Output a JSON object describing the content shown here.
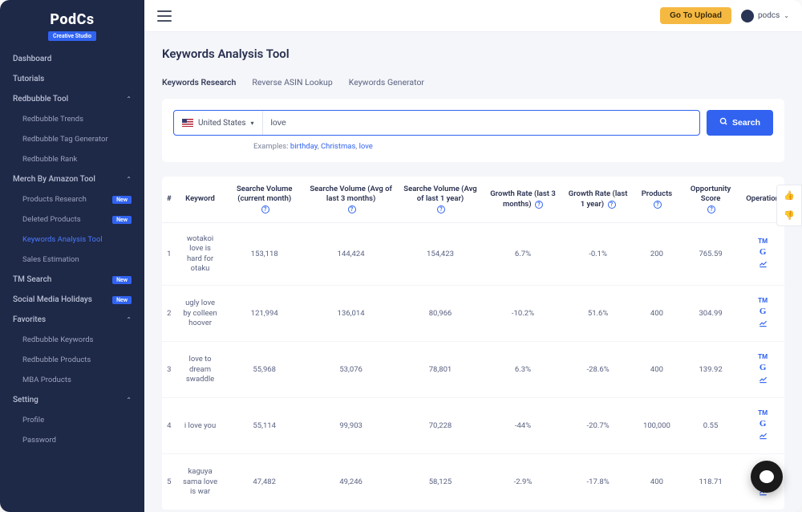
{
  "logo": {
    "brand": "PodCs",
    "sub": "Creative Studio"
  },
  "topbar": {
    "upload_btn": "Go To Upload",
    "username": "podcs"
  },
  "sidebar": {
    "dashboard": "Dashboard",
    "tutorials": "Tutorials",
    "redbubble_tool": "Redbubble Tool",
    "redbubble_trends": "Redbubble Trends",
    "redbubble_tag_gen": "Redbubble Tag Generator",
    "redbubble_rank": "Redbubble Rank",
    "merch_tool": "Merch By Amazon Tool",
    "products_research": "Products Research",
    "deleted_products": "Deleted Products",
    "keywords_analysis": "Keywords Analysis Tool",
    "sales_estimation": "Sales Estimation",
    "tm_search": "TM Search",
    "social_media": "Social Media Holidays",
    "favorites": "Favorites",
    "redbubble_keywords": "Redbubble Keywords",
    "redbubble_products": "Redbubble Products",
    "mba_products": "MBA Products",
    "setting": "Setting",
    "profile": "Profile",
    "password": "Password",
    "new_badge": "New"
  },
  "page": {
    "title": "Keywords Analysis Tool",
    "tabs": [
      "Keywords Research",
      "Reverse ASIN Lookup",
      "Keywords Generator"
    ],
    "country": "United States",
    "search_value": "love",
    "search_btn": "Search",
    "examples_label": "Examples:",
    "examples": [
      "birthday",
      "Christmas",
      "love"
    ]
  },
  "table": {
    "headers": {
      "num": "#",
      "keyword": "Keyword",
      "vol_current": "Searche Volume (current month)",
      "vol_3m": "Searche Volume (Avg of last 3 months)",
      "vol_1y": "Searche Volume (Avg of last 1 year)",
      "growth_3m": "Growth Rate (last 3 months)",
      "growth_1y": "Growth Rate (last 1 year)",
      "products": "Products",
      "opportunity": "Opportunity Score",
      "operation": "Operation"
    },
    "rows": [
      {
        "num": "1",
        "keyword": "wotakoi love is hard for otaku",
        "vol_current": "153,118",
        "vol_3m": "144,424",
        "vol_1y": "154,423",
        "growth_3m": "6.7%",
        "growth_1y": "-0.1%",
        "products": "200",
        "opportunity": "765.59"
      },
      {
        "num": "2",
        "keyword": "ugly love by colleen hoover",
        "vol_current": "121,994",
        "vol_3m": "136,014",
        "vol_1y": "80,966",
        "growth_3m": "-10.2%",
        "growth_1y": "51.6%",
        "products": "400",
        "opportunity": "304.99"
      },
      {
        "num": "3",
        "keyword": "love to dream swaddle",
        "vol_current": "55,968",
        "vol_3m": "53,076",
        "vol_1y": "78,801",
        "growth_3m": "6.3%",
        "growth_1y": "-28.6%",
        "products": "400",
        "opportunity": "139.92"
      },
      {
        "num": "4",
        "keyword": "i love you",
        "vol_current": "55,114",
        "vol_3m": "99,903",
        "vol_1y": "70,228",
        "growth_3m": "-44%",
        "growth_1y": "-20.7%",
        "products": "100,000",
        "opportunity": "0.55"
      },
      {
        "num": "5",
        "keyword": "kaguya sama love is war",
        "vol_current": "47,482",
        "vol_3m": "49,246",
        "vol_1y": "58,125",
        "growth_3m": "-2.9%",
        "growth_1y": "-17.8%",
        "products": "400",
        "opportunity": "118.71"
      }
    ],
    "op_tm": "TM",
    "op_g": "G"
  }
}
